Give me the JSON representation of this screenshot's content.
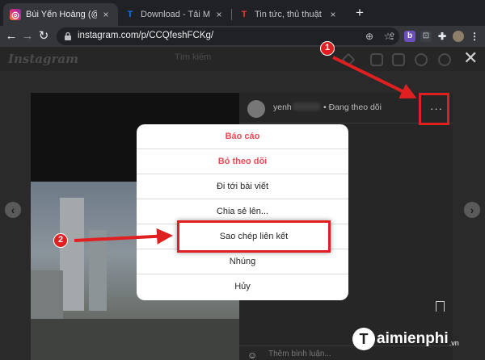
{
  "tabs": [
    {
      "title": "Bùi Yến Hoàng (@yenhoang",
      "favicon": "instagram-icon",
      "active": true
    },
    {
      "title": "Download - Tải Miễn Phí VN",
      "favicon": "taimienphi-t-icon",
      "active": false
    },
    {
      "title": "Tin tức, thủ thuật công nghệ",
      "favicon": "taimienphi-t-icon",
      "active": false
    }
  ],
  "newtab_label": "+",
  "tab_close_label": "×",
  "address": {
    "url": "instagram.com/p/CCQfeshFCKg/"
  },
  "toolbar_icons": [
    "back-icon",
    "forward-icon",
    "reload-icon",
    "lock-icon",
    "install-icon",
    "share-icon",
    "star-icon",
    "bitwarden-icon",
    "extension-icon",
    "puzzle-icon",
    "profile-icon"
  ],
  "instagram": {
    "logo": "Instagram",
    "search_placeholder": "Tìm kiếm",
    "post_header": {
      "username": "yenh",
      "follow_text": "• Đang theo dõi",
      "more_label": "···"
    },
    "comment_placeholder": "Thêm bình luận...",
    "close_label": "✕"
  },
  "modal": {
    "items": [
      {
        "label": "Báo cáo",
        "danger": true
      },
      {
        "label": "Bỏ theo dõi",
        "danger": true
      },
      {
        "label": "Đi tới bài viết",
        "danger": false
      },
      {
        "label": "Chia sẻ lên...",
        "danger": false
      },
      {
        "label": "Sao chép liên kết",
        "danger": false
      },
      {
        "label": "Nhúng",
        "danger": false
      },
      {
        "label": "Hủy",
        "danger": false
      }
    ]
  },
  "annotations": {
    "step1": "1",
    "step2": "2"
  },
  "watermark": {
    "letter": "T",
    "name": "aimienphi",
    "tld": ".vn"
  },
  "colors": {
    "annotation_red": "#e02020",
    "danger_red": "#ed4956",
    "tab_active": "#35363a",
    "tab_strip": "#202124"
  }
}
